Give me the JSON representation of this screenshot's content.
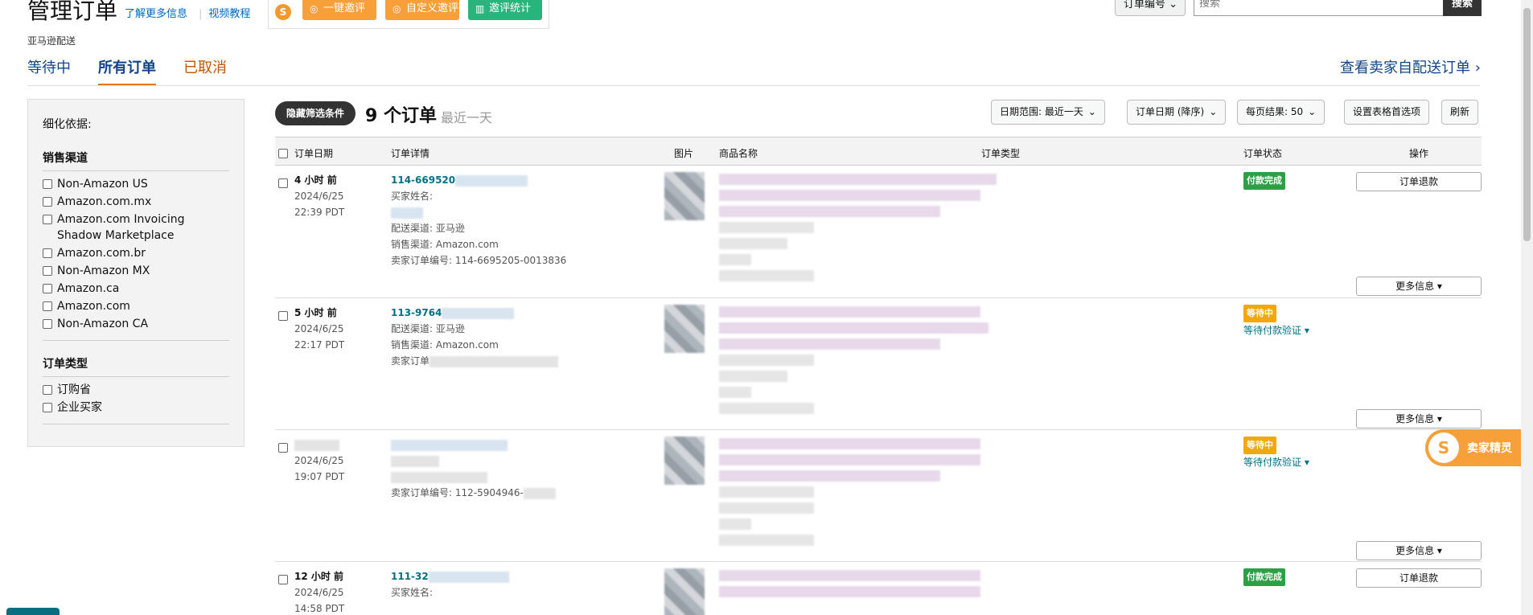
{
  "header": {
    "title": "管理订单",
    "learn_more": "了解更多信息",
    "video_tutorial": "视频教程"
  },
  "plugin": {
    "logo_glyph": "S",
    "btn_invite": "一键邀评",
    "btn_custom": "自定义邀评",
    "btn_stats": "邀评统计"
  },
  "search": {
    "select_value": "订单编号",
    "placeholder": "搜索",
    "button": "搜索"
  },
  "subcaption": "亚马逊配送",
  "tabs": [
    {
      "label": "等待中"
    },
    {
      "label": "所有订单"
    },
    {
      "label": "已取消"
    }
  ],
  "seller_fulfilled_link": "查看卖家自配送订单 ›",
  "sidebar": {
    "heading": "细化依据:",
    "channel_title": "销售渠道",
    "channels": [
      "Non-Amazon US",
      "Amazon.com.mx",
      "Amazon.com Invoicing Shadow Marketplace",
      "Amazon.com.br",
      "Non-Amazon MX",
      "Amazon.ca",
      "Amazon.com",
      "Non-Amazon CA"
    ],
    "type_title": "订单类型",
    "types": [
      "订购省",
      "企业买家"
    ]
  },
  "toolbar": {
    "hide_filters": "隐藏筛选条件",
    "order_count": "9 个订单",
    "order_range": "最近一天",
    "date_range": "日期范围:  最近一天",
    "sort": "订单日期 (降序)",
    "per_page": "每页结果:  50",
    "table_prefs": "设置表格首选项",
    "refresh": "刷新"
  },
  "table": {
    "headers": {
      "date": "订单日期",
      "details": "订单详情",
      "image": "图片",
      "product": "商品名称",
      "type": "订单类型",
      "status": "订单状态",
      "action": "操作"
    }
  },
  "orders": [
    {
      "age": "4 小时 前",
      "date": "2024/6/25",
      "time": "22:39 PDT",
      "order_id": "114-669520",
      "buyer_label": "买家姓名:",
      "fulfillment": "配送渠道: 亚马逊",
      "channel": "销售渠道: Amazon.com",
      "seller_order": "卖家订单编号: 114-6695205-0013836",
      "status": "付款完成",
      "status_sub": "",
      "action": "订单退款",
      "more": "更多信息 ▾"
    },
    {
      "age": "5 小时 前",
      "date": "2024/6/25",
      "time": "22:17 PDT",
      "order_id": "113-9764",
      "fulfillment": "配送渠道: 亚马逊",
      "channel": "销售渠道: Amazon.com",
      "seller_order": "卖家订单",
      "status": "等待中",
      "status_sub": "等待付款验证 ▾",
      "more": "更多信息 ▾"
    },
    {
      "date": "2024/6/25",
      "time": "19:07 PDT",
      "seller_order": "卖家订单编号: 112-5904946-",
      "status": "等待中",
      "status_sub": "等待付款验证 ▾",
      "more": "更多信息 ▾"
    },
    {
      "age": "12 小时 前",
      "date": "2024/6/25",
      "time": "14:58 PDT",
      "order_id": "111-32",
      "buyer_label": "买家姓名:",
      "status": "付款完成",
      "action": "订单退款"
    }
  ],
  "float_badge": {
    "glyph": "S",
    "label": "卖家精灵"
  }
}
